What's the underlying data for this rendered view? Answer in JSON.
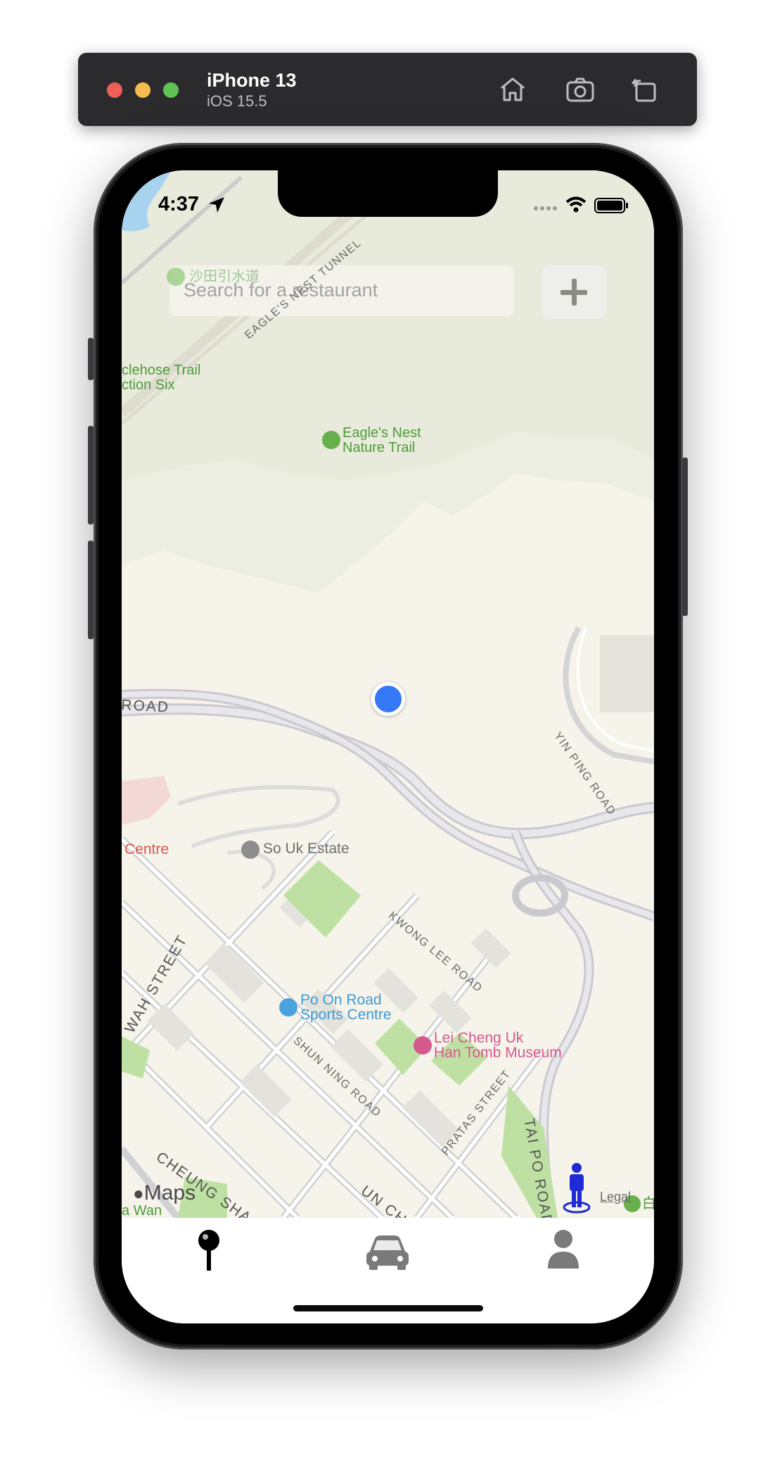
{
  "simulator": {
    "device_name": "iPhone 13",
    "os_version": "iOS 15.5",
    "buttons": [
      "home-icon",
      "screenshot-icon",
      "rotate-icon"
    ]
  },
  "status_bar": {
    "time": "4:37"
  },
  "search": {
    "placeholder": "Search for a restaurant"
  },
  "add_button": {
    "icon": "plus-icon"
  },
  "map": {
    "labels": {
      "chinese_trail": "沙田引水道",
      "maclehose_1": "clehose Trail",
      "maclehose_2": "ction Six",
      "eagles_nest_1": "Eagle's Nest",
      "eagles_nest_2": "Nature Trail",
      "centre": "Centre",
      "so_uk": "So Uk Estate",
      "po_on_1": "Po On Road",
      "po_on_2": "Sports Centre",
      "lei_cheng_1": "Lei Cheng Uk",
      "lei_cheng_2": "Han Tomb Museum",
      "wan": "a Wan",
      "bottom_right_chinese": "白"
    },
    "streets": {
      "eagle_tunnel": "EAGLE'S NEST TUNNEL",
      "road_left": "ROAD",
      "yin_ping": "YIN PING ROAD",
      "kwong_lee": "KWONG LEE ROAD",
      "wah_street": "WAH STREET",
      "shun_ning": "SHUN NING ROAD",
      "pratas": "PRATAS STREET",
      "tai_po": "TAI PO ROAD",
      "cheung_sha": "CHEUNG SHA W",
      "un_chau": "UN CHA"
    },
    "attribution": {
      "logo_text": "Maps",
      "legal": "Legal"
    }
  },
  "tabbar": {
    "tabs": [
      {
        "icon": "map-pin-icon",
        "active": true
      },
      {
        "icon": "car-icon",
        "active": false
      },
      {
        "icon": "person-icon",
        "active": false
      }
    ]
  },
  "colors": {
    "accent_user_location": "#3478f6",
    "poi_green": "#4e9a3b",
    "poi_blue": "#3d9bd6",
    "poi_pink": "#d6598e",
    "poi_red": "#d9574f"
  }
}
